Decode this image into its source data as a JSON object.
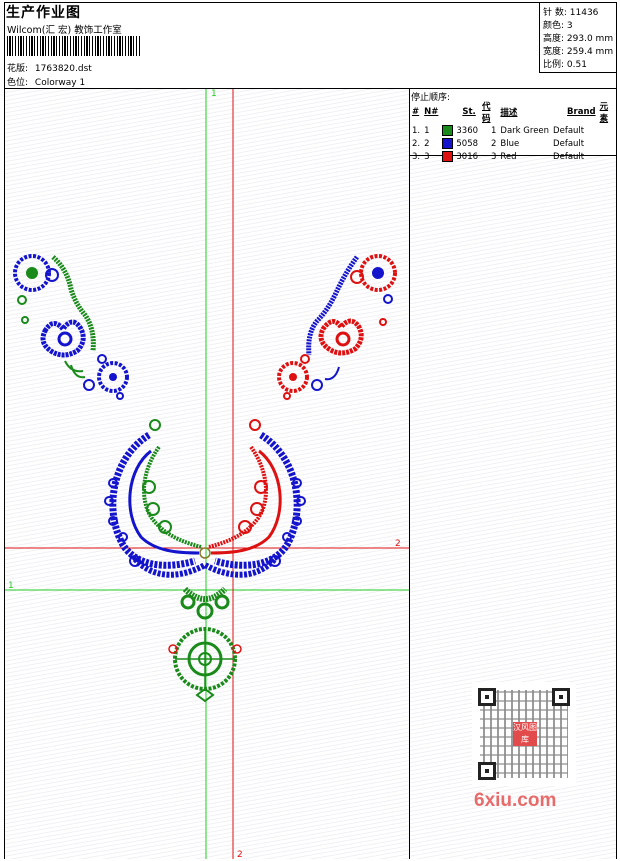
{
  "header": {
    "title": "生产作业图",
    "subtitle": "Wilcom(汇 宏) 教饰工作室",
    "design_label": "花版:",
    "design_file": "1763820.dst",
    "colorway_label": "色位:",
    "colorway": "Colorway 1"
  },
  "stats": {
    "stitches_label": "针 数:",
    "stitches": "11436",
    "colors_label": "颜色:",
    "colors": "3",
    "height_label": "高度:",
    "height": "293.0 mm",
    "width_label": "宽度:",
    "width": "259.4 mm",
    "scale_label": "比例:",
    "scale": "0.51"
  },
  "stop_sequence": {
    "title": "停止顺序:",
    "columns": [
      "#",
      "N#",
      "St.",
      "代码",
      "描述",
      "Brand",
      "元素"
    ],
    "rows": [
      {
        "num": "1.",
        "n": "1",
        "color": "#1a8a1a",
        "st": "3360",
        "code": "1",
        "desc": "Dark Green",
        "brand": "Default"
      },
      {
        "num": "2.",
        "n": "2",
        "color": "#1414cc",
        "st": "5058",
        "code": "2",
        "desc": "Blue",
        "brand": "Default"
      },
      {
        "num": "3.",
        "n": "3",
        "color": "#dd1111",
        "st": "3016",
        "code": "3",
        "desc": "Red",
        "brand": "Default"
      }
    ]
  },
  "axes": {
    "green_label": "1",
    "red_label": "2"
  },
  "watermark": "6xiu.com",
  "qr_logo": "汉风图库"
}
